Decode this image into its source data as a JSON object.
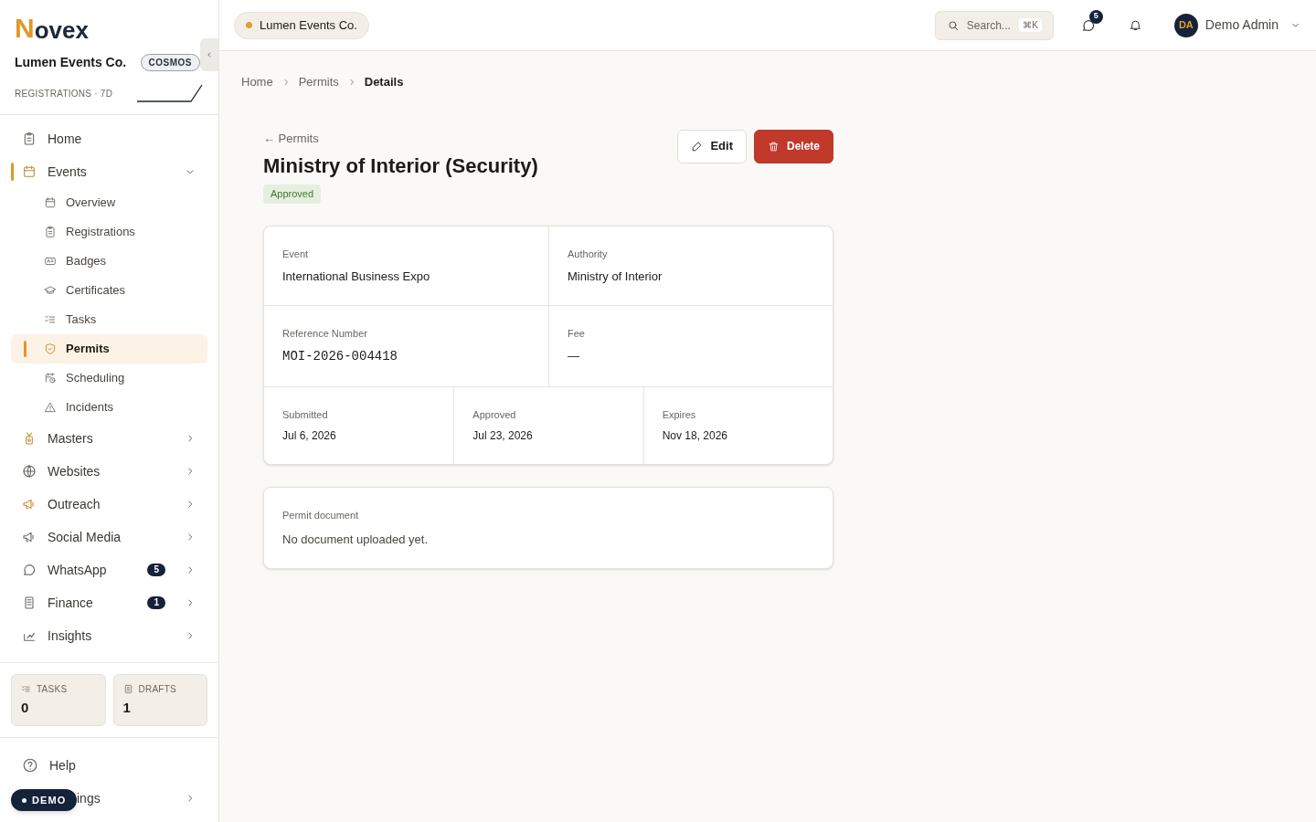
{
  "brand": {
    "logo_mark": "N",
    "logo_rest": "ovex",
    "org": "Lumen Events Co.",
    "plan": "COSMOS",
    "metric": "REGISTRATIONS · 7D"
  },
  "nav": [
    {
      "label": "Home",
      "selected": false
    },
    {
      "label": "Events",
      "selected": true,
      "expanded": true,
      "children": [
        {
          "label": "Overview",
          "selected": false
        },
        {
          "label": "Registrations",
          "selected": false
        },
        {
          "label": "Badges",
          "selected": false
        },
        {
          "label": "Certificates",
          "selected": false
        },
        {
          "label": "Tasks",
          "selected": false
        },
        {
          "label": "Permits",
          "selected": true
        },
        {
          "label": "Scheduling",
          "selected": false
        },
        {
          "label": "Incidents",
          "selected": false
        }
      ]
    },
    {
      "label": "Masters",
      "selected": false,
      "expanded": false
    },
    {
      "label": "Websites",
      "selected": false,
      "expanded": false
    },
    {
      "label": "Outreach",
      "selected": false,
      "expanded": false
    },
    {
      "label": "Social Media",
      "selected": false,
      "expanded": false
    },
    {
      "label": "WhatsApp",
      "selected": false,
      "expanded": false,
      "badge": "5"
    },
    {
      "label": "Finance",
      "selected": false,
      "expanded": false,
      "badge": "1"
    },
    {
      "label": "Insights",
      "selected": false,
      "expanded": false
    }
  ],
  "stats": [
    {
      "label": "TASKS",
      "value": "0"
    },
    {
      "label": "DRAFTS",
      "value": "1"
    }
  ],
  "footer_nav": [
    {
      "label": "Help"
    },
    {
      "label": "ings",
      "expanded": false
    }
  ],
  "demo_badge": "DEMO",
  "header": {
    "org_chip": "Lumen Events Co.",
    "search_placeholder": "Search...",
    "shortcut": "⌘K",
    "messages_badge": "5",
    "user_initials": "DA",
    "user_name": "Demo Admin"
  },
  "breadcrumbs": [
    {
      "label": "Home",
      "current": false
    },
    {
      "label": "Permits",
      "current": false
    },
    {
      "label": "Details",
      "current": true
    }
  ],
  "back_link": "← Permits",
  "title": "Ministry of Interior (Security)",
  "status": "Approved",
  "actions": [
    {
      "label": "Edit",
      "kind": "secondary"
    },
    {
      "label": "Delete",
      "kind": "danger"
    }
  ],
  "details": [
    [
      {
        "label": "Event",
        "value": "International Business Expo"
      },
      {
        "label": "Authority",
        "value": "Ministry of Interior"
      }
    ],
    [
      {
        "label": "Reference Number",
        "value": "MOI-2026-004418",
        "kind": "code"
      },
      {
        "label": "Fee",
        "value": "—"
      }
    ],
    [
      {
        "label": "Submitted",
        "value": "Jul 6, 2026"
      },
      {
        "label": "Approved",
        "value": "Jul 23, 2026"
      },
      {
        "label": "Expires",
        "value": "Nov 18, 2026"
      }
    ]
  ],
  "document": {
    "label": "Permit document",
    "value": "No document uploaded yet."
  }
}
